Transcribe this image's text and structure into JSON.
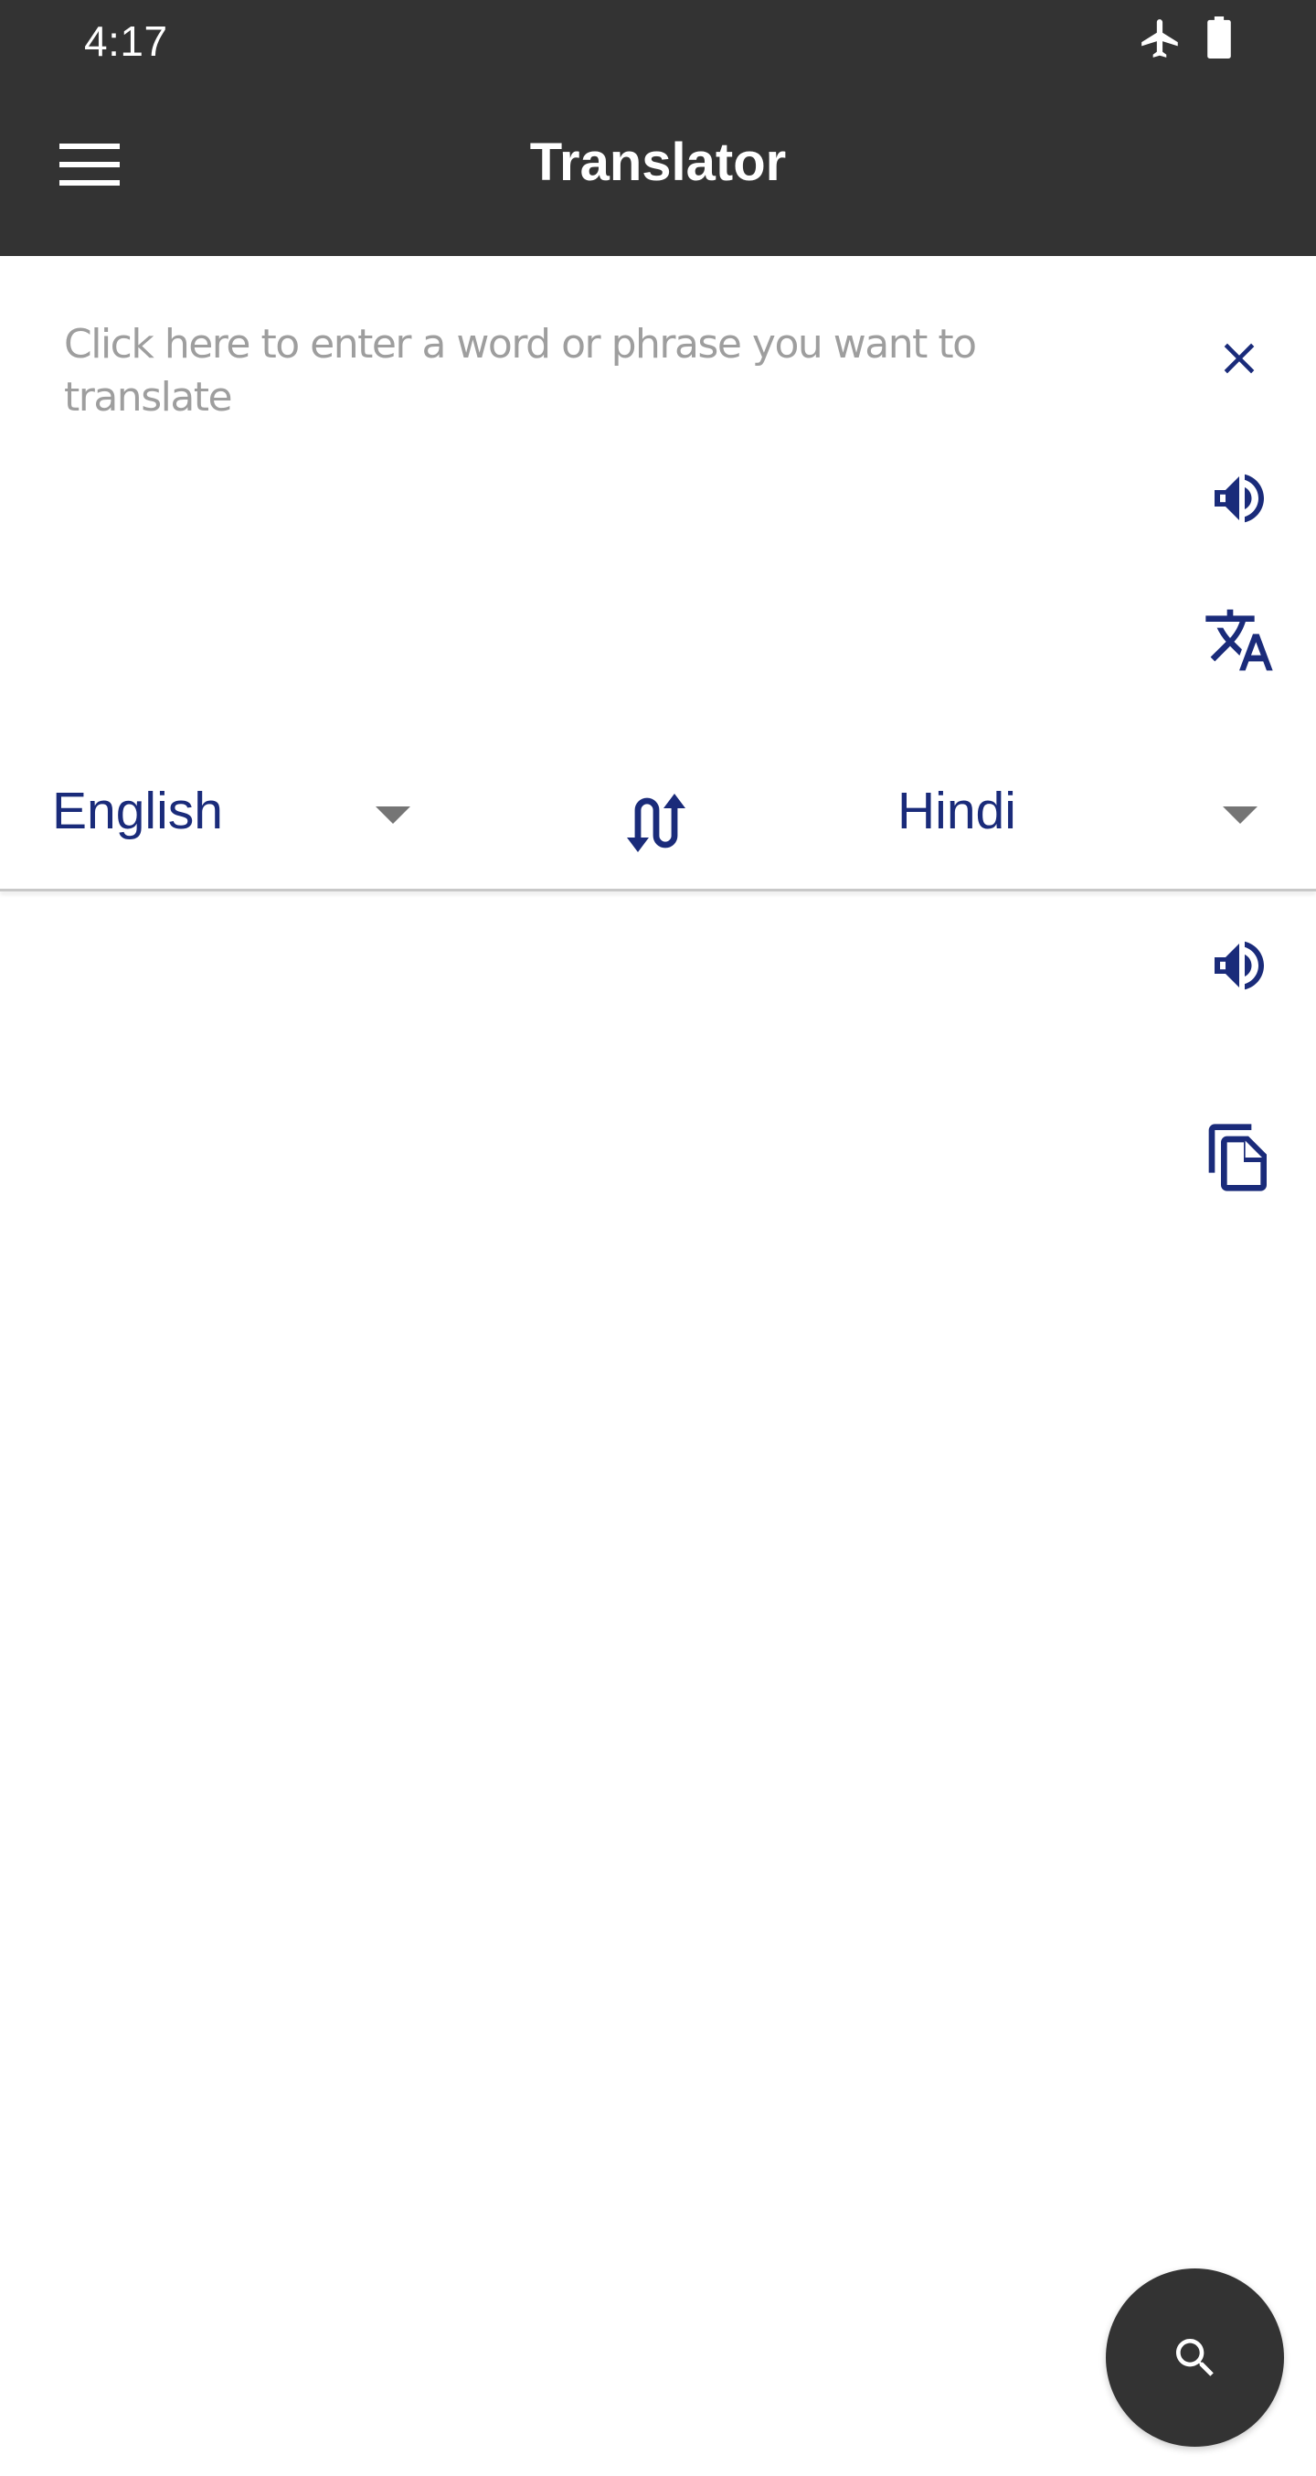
{
  "status_bar": {
    "time": "4:17",
    "icons": [
      "airplane-mode-icon",
      "battery-icon"
    ]
  },
  "app_bar": {
    "title": "Translator",
    "menu_icon": "hamburger-menu-icon"
  },
  "source": {
    "value": "",
    "placeholder": "Click here to enter a word or phrase you want to translate",
    "actions": [
      {
        "name": "clear",
        "icon": "close-icon"
      },
      {
        "name": "speak",
        "icon": "volume-icon"
      },
      {
        "name": "translate",
        "icon": "translate-icon"
      }
    ]
  },
  "languages": {
    "source": "English",
    "target": "Hindi",
    "swap_icon": "swap-vertical-icon"
  },
  "output": {
    "text": "",
    "actions": [
      {
        "name": "speak",
        "icon": "volume-icon"
      },
      {
        "name": "copy",
        "icon": "copy-icon"
      }
    ]
  },
  "fab": {
    "icon": "search-icon"
  },
  "colors": {
    "app_bar": "#333333",
    "accent": "#1a2b7a",
    "placeholder": "#9e9e9e",
    "dropdown_arrow": "#757575",
    "background": "#ffffff"
  }
}
